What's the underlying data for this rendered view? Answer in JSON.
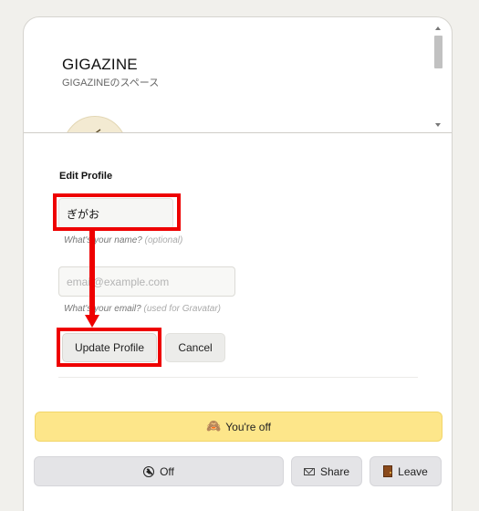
{
  "space": {
    "title": "GIGAZINE",
    "subtitle": "GIGAZINEのスペース"
  },
  "profile": {
    "heading": "Edit Profile",
    "name_value": "ぎがお",
    "name_hint": "What's your name?",
    "name_hint_optional": "(optional)",
    "email_value": "",
    "email_placeholder": "email@example.com",
    "email_hint": "What's your email?",
    "email_hint_optional": "(used for Gravatar)",
    "update_label": "Update Profile",
    "cancel_label": "Cancel"
  },
  "status": {
    "icon": "see-no-evil-monkey-icon",
    "emoji": "🙈",
    "text": "You're off",
    "color": "#fde68a"
  },
  "actions": {
    "off_label": "Off",
    "off_icon": "mute-icon",
    "share_label": "Share",
    "share_icon": "envelope-icon",
    "leave_label": "Leave",
    "leave_icon": "door-icon"
  },
  "annotation": {
    "highlight_color": "#ee0000"
  }
}
